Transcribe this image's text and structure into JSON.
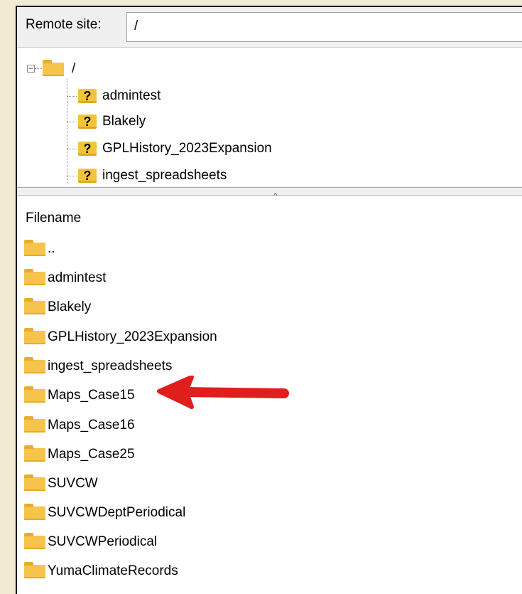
{
  "remote_site": {
    "label": "Remote site:",
    "path": "/"
  },
  "tree": {
    "root": "/",
    "children": [
      "admintest",
      "Blakely",
      "GPLHistory_2023Expansion",
      "ingest_spreadsheets"
    ],
    "child_icon": "unknown-folder-icon"
  },
  "file_list": {
    "column_header": "Filename",
    "files": [
      "..",
      "admintest",
      "Blakely",
      "GPLHistory_2023Expansion",
      "ingest_spreadsheets",
      "Maps_Case15",
      "Maps_Case16",
      "Maps_Case25",
      "SUVCW",
      "SUVCWDeptPeriodical",
      "SUVCWPeriodical",
      "YumaClimateRecords"
    ],
    "highlighted": "Maps_Case15"
  },
  "colors": {
    "folder": "#f6c34b",
    "annotation_arrow": "#e01e1e",
    "background": "#f3ead3"
  }
}
